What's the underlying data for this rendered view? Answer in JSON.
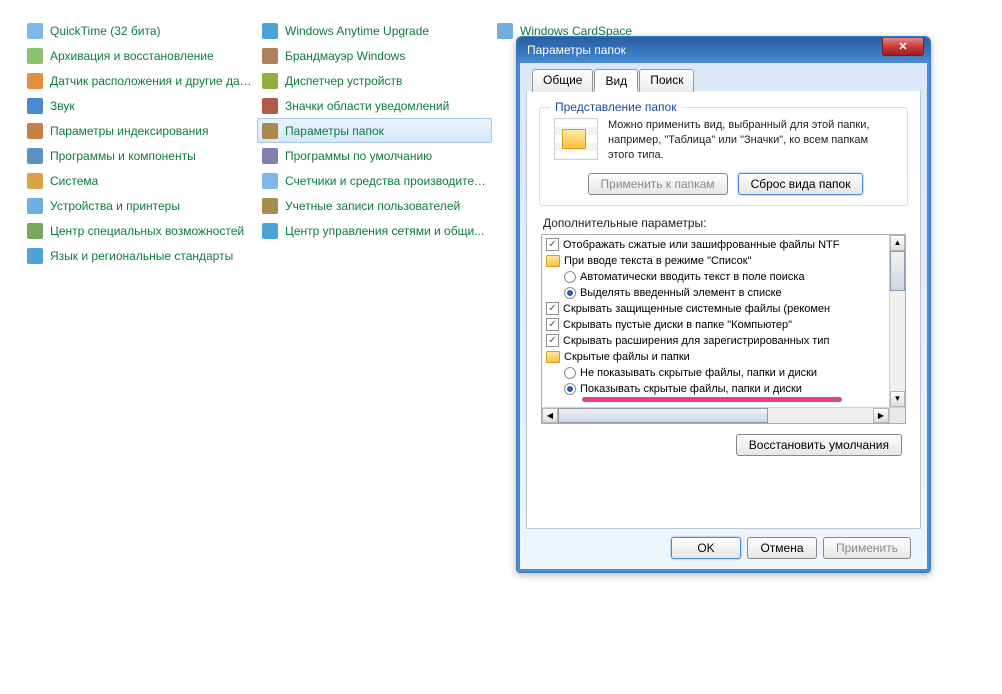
{
  "cp": {
    "col1": [
      {
        "label": "QuickTime (32 бита)"
      },
      {
        "label": "Архивация и восстановление"
      },
      {
        "label": "Датчик расположения и другие дат..."
      },
      {
        "label": "Звук"
      },
      {
        "label": "Параметры индексирования"
      },
      {
        "label": "Программы и компоненты"
      },
      {
        "label": "Система"
      },
      {
        "label": "Устройства и принтеры"
      },
      {
        "label": "Центр специальных возможностей"
      },
      {
        "label": "Язык и региональные стандарты"
      }
    ],
    "col2": [
      {
        "label": "Windows Anytime Upgrade"
      },
      {
        "label": "Брандмауэр Windows"
      },
      {
        "label": "Диспетчер устройств"
      },
      {
        "label": "Значки области уведомлений"
      },
      {
        "label": "Параметры папок",
        "selected": true
      },
      {
        "label": "Программы по умолчанию"
      },
      {
        "label": "Счетчики и средства производител..."
      },
      {
        "label": "Учетные записи пользователей"
      },
      {
        "label": "Центр управления сетями и общи..."
      }
    ],
    "col3": [
      {
        "label": "Windows CardSpace"
      }
    ]
  },
  "dialog": {
    "title": "Параметры папок",
    "tabs": {
      "general": "Общие",
      "view": "Вид",
      "search": "Поиск",
      "active": "Вид"
    },
    "group_view": {
      "title": "Представление папок",
      "text": "Можно применить вид, выбранный для этой папки, например, \"Таблица\" или \"Значки\", ко всем папкам этого типа.",
      "apply_folders": "Применить к папкам",
      "reset_folders": "Сброс вида папок"
    },
    "advanced_label": "Дополнительные параметры:",
    "tree": [
      {
        "type": "check",
        "checked": true,
        "indent": 0,
        "text": "Отображать сжатые или зашифрованные файлы NTF"
      },
      {
        "type": "folder",
        "indent": 0,
        "text": "При вводе текста в режиме \"Список\""
      },
      {
        "type": "radio",
        "checked": false,
        "indent": 1,
        "text": "Автоматически вводить текст в поле поиска"
      },
      {
        "type": "radio",
        "checked": true,
        "indent": 1,
        "text": "Выделять введенный элемент в списке"
      },
      {
        "type": "check",
        "checked": true,
        "indent": 0,
        "text": "Скрывать защищенные системные файлы (рекомен"
      },
      {
        "type": "check",
        "checked": true,
        "indent": 0,
        "text": "Скрывать пустые диски в папке \"Компьютер\""
      },
      {
        "type": "check",
        "checked": true,
        "indent": 0,
        "text": "Скрывать расширения для зарегистрированных тип"
      },
      {
        "type": "folder",
        "indent": 0,
        "text": "Скрытые файлы и папки"
      },
      {
        "type": "radio",
        "checked": false,
        "indent": 1,
        "text": "Не показывать скрытые файлы, папки и диски"
      },
      {
        "type": "radio",
        "checked": true,
        "indent": 1,
        "text": "Показывать скрытые файлы, папки и диски"
      }
    ],
    "restore_defaults": "Восстановить умолчания",
    "ok": "OK",
    "cancel": "Отмена",
    "apply": "Применить"
  }
}
